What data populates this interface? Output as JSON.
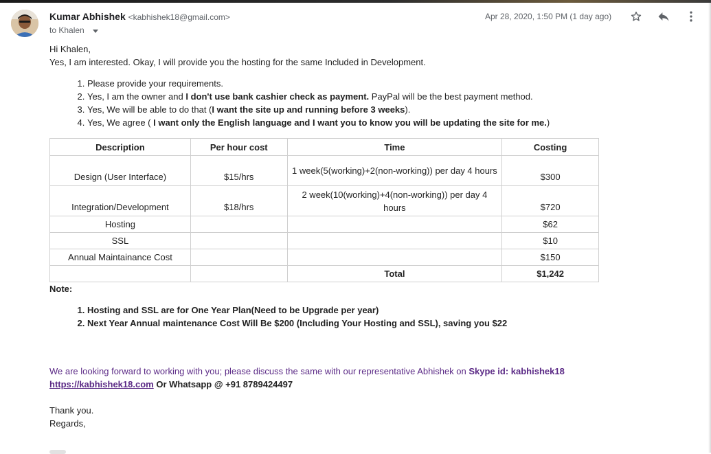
{
  "header": {
    "sender_name": "Kumar Abhishek",
    "sender_email": "<kabhishek18@gmail.com>",
    "to_label": "to Khalen",
    "date": "Apr 28, 2020, 1:50 PM (1 day ago)",
    "icons": {
      "star": "star-icon",
      "reply": "reply-icon",
      "more": "more-vert-icon"
    },
    "accent_color": "#5b2a86"
  },
  "body": {
    "greeting": "Hi Khalen,",
    "intro": "Yes, I am interested. Okay, I will provide you the hosting for the same Included in Development.",
    "list": [
      {
        "text": "Please provide your requirements."
      },
      {
        "pre": "Yes, I am the owner and ",
        "bold": "I don't use bank cashier check as payment.",
        "post": " PayPal will be the best payment method."
      },
      {
        "pre": " Yes, We will be able to do that (",
        "bold": "I want the site up and running before 3 weeks",
        "post": ")."
      },
      {
        "pre": "Yes, We agree  ( ",
        "bold": "I want only the English language and I want you to know you will be updating the site for me.",
        "post": ")"
      }
    ]
  },
  "table": {
    "headers": [
      "Description",
      "Per hour cost",
      "Time",
      "Costing"
    ],
    "rows": [
      [
        "Design (User Interface)",
        "$15/hrs",
        "1 week(5(working)+2(non-working)) per day 4 hours",
        "$300"
      ],
      [
        "Integration/Development",
        "$18/hrs",
        "2 week(10(working)+4(non-working)) per day 4 hours",
        "$720"
      ],
      [
        "Hosting",
        "",
        "",
        "$62"
      ],
      [
        "SSL",
        "",
        "",
        "$10"
      ],
      [
        "Annual Maintainance Cost",
        "",
        "",
        "$150"
      ],
      [
        "",
        "",
        "Total",
        "$1,242"
      ]
    ]
  },
  "note": {
    "label": "Note:",
    "items": [
      "Hosting and SSL are for One Year Plan(Need to be Upgrade per year)",
      "Next Year Annual maintenance Cost Will Be $200 (Including Your Hosting and SSL), saving you $22"
    ]
  },
  "closing": {
    "forward_text": "We are looking forward to working with you; please discuss the same with our representative Abhishek on ",
    "skype": "Skype id: kabhishek18",
    "link": "https://kabhishek18.com",
    "whatsapp": "  Or Whatsapp @ +91 8789424497",
    "thanks": "Thank you.",
    "regards": "Regards,"
  }
}
